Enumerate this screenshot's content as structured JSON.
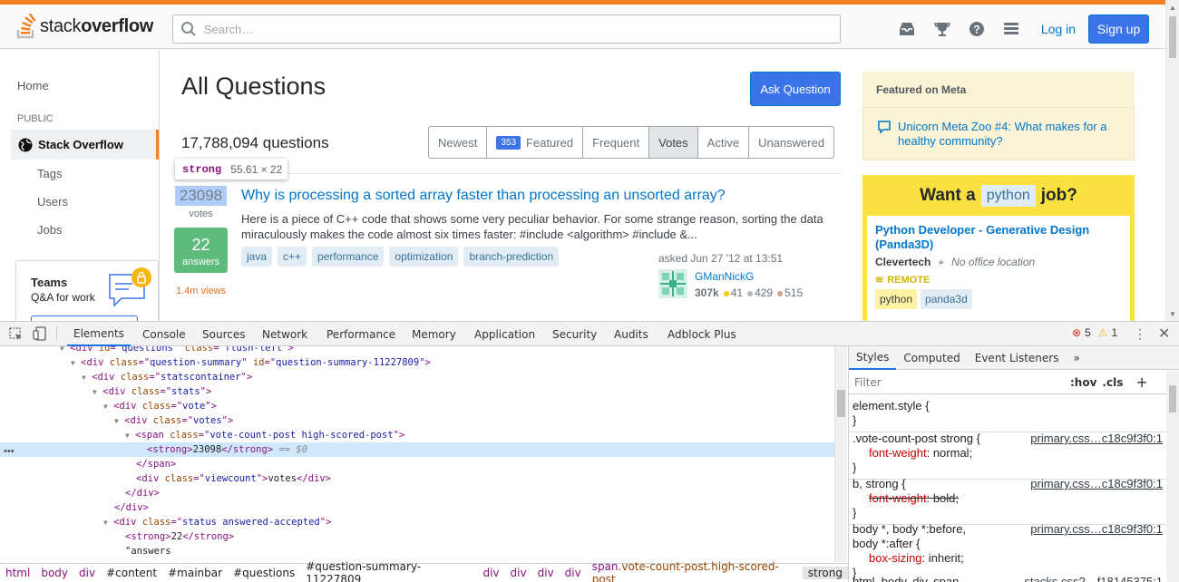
{
  "header": {
    "logo_prefix": "stack",
    "logo_bold": "overflow",
    "search_placeholder": "Search…",
    "login_label": "Log in",
    "signup_label": "Sign up"
  },
  "sidebar": {
    "home": "Home",
    "section": "PUBLIC",
    "stack_overflow": "Stack Overflow",
    "tags": "Tags",
    "users": "Users",
    "jobs": "Jobs",
    "teams_title": "Teams",
    "teams_sub": "Q&A for work"
  },
  "main": {
    "title": "All Questions",
    "ask_label": "Ask Question",
    "count": "17,788,094 questions",
    "filters": [
      {
        "label": "Newest",
        "badge": ""
      },
      {
        "label": "Featured",
        "badge": "353"
      },
      {
        "label": "Frequent",
        "badge": ""
      },
      {
        "label": "Votes",
        "badge": ""
      },
      {
        "label": "Active",
        "badge": ""
      },
      {
        "label": "Unanswered",
        "badge": ""
      }
    ],
    "active_filter": "Votes"
  },
  "tooltip": {
    "tag": "strong",
    "dims": "55.61 × 22"
  },
  "question": {
    "votes": "23098",
    "votes_label": "votes",
    "answers": "22",
    "answers_label": "answers",
    "views": "1.4m views",
    "title": "Why is processing a sorted array faster than processing an unsorted array?",
    "excerpt": "Here is a piece of C++ code that shows some very peculiar behavior. For some strange reason, sorting the data miraculously makes the code almost six times faster: #include <algorithm> #include &...",
    "tags": [
      "java",
      "c++",
      "performance",
      "optimization",
      "branch-prediction"
    ],
    "asked": "asked Jun 27 '12 at 13:51",
    "user": "GManNickG",
    "rep": "307k",
    "gold": "41",
    "silver": "429",
    "bronze": "515"
  },
  "meta": {
    "header": "Featured on Meta",
    "item": "Unicorn Meta Zoo #4: What makes for a healthy community?"
  },
  "job": {
    "want_prefix": "Want a",
    "keyword": "python",
    "want_suffix": "job?",
    "title": "Python Developer - Generative Design (Panda3D)",
    "company": "Clevertech",
    "location": "No office location",
    "remote": "REMOTE",
    "tags": [
      "python",
      "panda3d"
    ]
  },
  "devtools": {
    "tabs": [
      "Elements",
      "Console",
      "Sources",
      "Network",
      "Performance",
      "Memory",
      "Application",
      "Security",
      "Audits",
      "Adblock Plus"
    ],
    "errors": "5",
    "warnings": "1",
    "elements": [
      {
        "indent": 0,
        "arrow": "▼",
        "open": "<div ",
        "attrs": [
          [
            "id",
            "questions"
          ],
          [
            "class",
            "flush-left"
          ]
        ],
        "close": ">",
        "text": ""
      },
      {
        "indent": 1,
        "arrow": "▼",
        "open": "<div ",
        "attrs": [
          [
            "class",
            "question-summary"
          ],
          [
            "id",
            "question-summary-11227809"
          ]
        ],
        "close": ">",
        "text": ""
      },
      {
        "indent": 2,
        "arrow": "▼",
        "open": "<div ",
        "attrs": [
          [
            "class",
            "statscontainer"
          ]
        ],
        "close": ">",
        "text": ""
      },
      {
        "indent": 3,
        "arrow": "▼",
        "open": "<div ",
        "attrs": [
          [
            "class",
            "stats"
          ]
        ],
        "close": ">",
        "text": ""
      },
      {
        "indent": 4,
        "arrow": "▼",
        "open": "<div ",
        "attrs": [
          [
            "class",
            "vote"
          ]
        ],
        "close": ">",
        "text": ""
      },
      {
        "indent": 5,
        "arrow": "▼",
        "open": "<div ",
        "attrs": [
          [
            "class",
            "votes"
          ]
        ],
        "close": ">",
        "text": ""
      },
      {
        "indent": 6,
        "arrow": "▼",
        "open": "<span ",
        "attrs": [
          [
            "class",
            "vote-count-post high-scored-post"
          ]
        ],
        "close": ">",
        "text": ""
      },
      {
        "indent": 7,
        "arrow": "",
        "open": "<strong>",
        "attrs": [],
        "close": "",
        "text": "23098",
        "end": "</strong>",
        "suffix": " == $0",
        "selected": true
      },
      {
        "indent": 6,
        "arrow": "",
        "open": "</span>",
        "attrs": [],
        "close": "",
        "text": ""
      },
      {
        "indent": 6,
        "arrow": "",
        "open": "<div ",
        "attrs": [
          [
            "class",
            "viewcount"
          ]
        ],
        "close": ">",
        "text": "votes",
        "end": "</div>"
      },
      {
        "indent": 5,
        "arrow": "",
        "open": "</div>",
        "attrs": [],
        "close": "",
        "text": ""
      },
      {
        "indent": 4,
        "arrow": "",
        "open": "</div>",
        "attrs": [],
        "close": "",
        "text": ""
      },
      {
        "indent": 4,
        "arrow": "▼",
        "open": "<div ",
        "attrs": [
          [
            "class",
            "status answered-accepted"
          ]
        ],
        "close": ">",
        "text": ""
      },
      {
        "indent": 5,
        "arrow": "",
        "open": "<strong>",
        "attrs": [],
        "close": "",
        "text": "22",
        "end": "</strong>"
      },
      {
        "indent": 5,
        "arrow": "",
        "open": "",
        "attrs": [],
        "close": "",
        "text": "\"answers"
      }
    ],
    "breadcrumbs": [
      "html",
      "body",
      "div",
      "#content",
      "#mainbar",
      "#questions",
      "#question-summary-11227809",
      "div",
      "div",
      "div",
      "div",
      "span.vote-count-post.high-scored-post",
      "strong"
    ],
    "style_tabs": [
      "Styles",
      "Computed",
      "Event Listeners"
    ],
    "filter_placeholder": "Filter",
    "hov": ":hov",
    "cls": ".cls",
    "rules": [
      {
        "selector": "element.style {",
        "source": "",
        "props": []
      },
      {
        "selector": ".vote-count-post strong {",
        "source": "primary.css…c18c9f3f0:1",
        "props": [
          {
            "name": "font-weight",
            "value": "normal;",
            "strike": false
          }
        ]
      },
      {
        "selector": "b, strong {",
        "source": "primary.css…c18c9f3f0:1",
        "props": [
          {
            "name": "font-weight",
            "value": "bold;",
            "strike": true
          }
        ]
      },
      {
        "selector": "body *, body *:before,\nbody *:after {",
        "source": "primary.css…c18c9f3f0:1",
        "props": [
          {
            "name": "box-sizing",
            "value": "inherit;",
            "strike": false
          }
        ]
      },
      {
        "selector": "html, body, div, span,",
        "source": "stacks.css?…f18145375:1",
        "props": []
      }
    ]
  }
}
